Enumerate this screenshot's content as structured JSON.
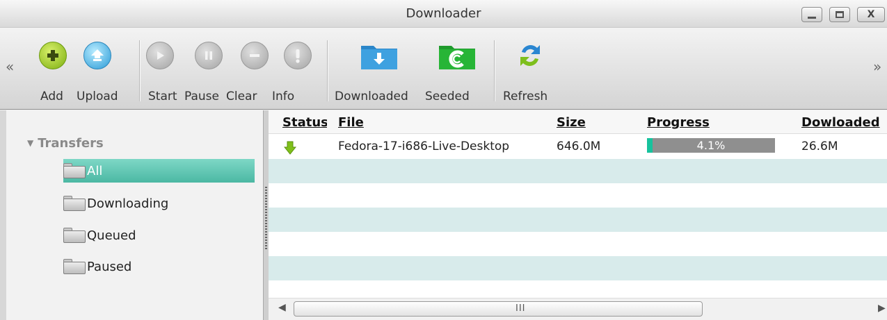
{
  "window": {
    "title": "Downloader",
    "minimize_label": "",
    "maximize_label": "",
    "close_label": "X"
  },
  "toolbar": {
    "scroll_left": "«",
    "scroll_right": "»",
    "add_label": "Add",
    "upload_label": "Upload",
    "start_label": "Start",
    "pause_label": "Pause",
    "clear_label": "Clear",
    "info_label": "Info",
    "downloaded_label": "Downloaded",
    "seeded_label": "Seeded",
    "refresh_label": "Refresh"
  },
  "sidebar": {
    "root_label": "Transfers",
    "items": [
      {
        "label": "All",
        "selected": true
      },
      {
        "label": "Downloading",
        "selected": false
      },
      {
        "label": "Queued",
        "selected": false
      },
      {
        "label": "Paused",
        "selected": false
      }
    ]
  },
  "grid": {
    "columns": {
      "status": "Status",
      "file": "File",
      "size": "Size",
      "progress": "Progress",
      "downloaded": "Dowloaded"
    },
    "rows": [
      {
        "status_icon": "download-arrow-icon",
        "file": "Fedora-17-i686-Live-Desktop",
        "size": "646.0M",
        "progress_text": "4.1%",
        "progress_value": 0.041,
        "downloaded": "26.6M"
      }
    ],
    "scroll_grip": "III"
  },
  "colors": {
    "selection": "#4bb8a3",
    "progress_fill": "#17c29d",
    "progress_track": "#8f8f8f",
    "row_alt": "#d8ebeb"
  }
}
